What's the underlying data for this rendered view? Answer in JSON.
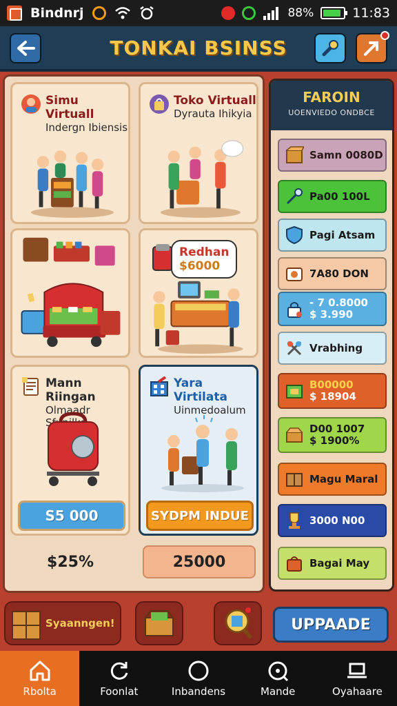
{
  "status_bar": {
    "app_name": "Bindnrj",
    "battery_text": "88%",
    "battery_level": 0.88,
    "time": "11:83"
  },
  "header": {
    "title": "TONKAI BSINSS"
  },
  "cards": {
    "card1": {
      "title": "Simu Virtuall",
      "subtitle": "Indergn Ibiensis"
    },
    "card2": {
      "title": "Toko Virtuall",
      "subtitle": "Dyrauta Ihikyia"
    },
    "card4": {
      "sale_title": "Redhan",
      "sale_price": "$6000"
    },
    "card5": {
      "title": "Mann Riingan",
      "subtitle": "Olmaadr Sfunilke",
      "button_label": "S5 000"
    },
    "card6": {
      "title": "Yara Virtilata",
      "subtitle": "Uinmedoalum",
      "button_label": "SYDPM INDUE"
    }
  },
  "price_left": "$25%",
  "price_right": "25000",
  "side_panel": {
    "title": "FAROIN",
    "subtitle": "UOENVIEDO ONDBCE",
    "items": [
      {
        "line1": "Samn 0080D",
        "line2": ""
      },
      {
        "line1": "Pa00 100L",
        "line2": ""
      },
      {
        "line1": "Pagi Atsam",
        "line2": ""
      },
      {
        "line1": "7A80 DON",
        "line2": ""
      },
      {
        "line1": "- 7 0.8000",
        "line2": "$ 3.990"
      },
      {
        "line1": "Vrabhing",
        "line2": ""
      },
      {
        "line1": "B00000",
        "line2": "$ 18904"
      },
      {
        "line1": "D00 1007",
        "line2": "$ 1900%"
      },
      {
        "line1": "Magu Maral",
        "line2": ""
      },
      {
        "line1": "3000 N00",
        "line2": ""
      },
      {
        "line1": "Bagai May",
        "line2": ""
      }
    ]
  },
  "bottom_strip": {
    "slot1_label": "Syaanngen!",
    "upgrade_label": "UPPAADE"
  },
  "bottom_nav": [
    {
      "label": "Rbolta",
      "icon": "home-icon"
    },
    {
      "label": "Foonlat",
      "icon": "refresh-icon"
    },
    {
      "label": "Inbandens",
      "icon": "circle-icon"
    },
    {
      "label": "Mande",
      "icon": "search-icon"
    },
    {
      "label": "Oyahaare",
      "icon": "laptop-icon"
    }
  ],
  "colors": {
    "accent_orange": "#e86e22",
    "header_navy": "#1f3d55",
    "frame_red": "#b8402e",
    "title_gold": "#f7c84a"
  }
}
